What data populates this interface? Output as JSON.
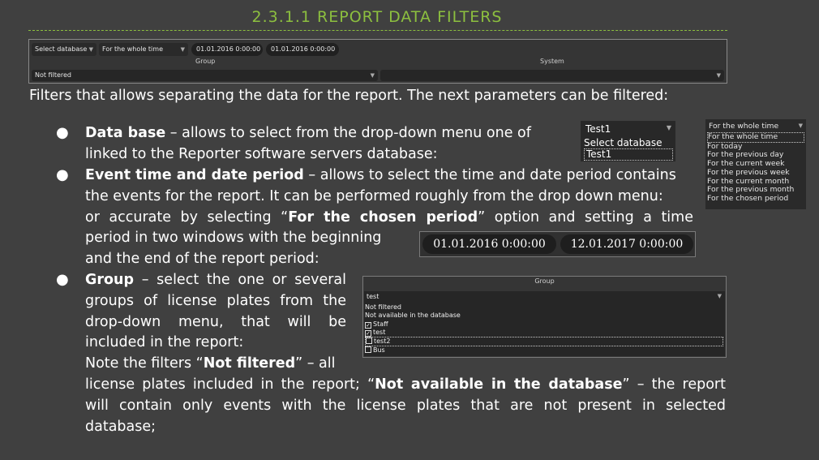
{
  "heading": "2.3.1.1 REPORT DATA FILTERS",
  "panel": {
    "database_select": "Select database",
    "time_select": "For the whole time",
    "date_from": "01.01.2016 0:00:00",
    "date_to": "01.01.2016 0:00:00",
    "group_label": "Group",
    "system_label": "System",
    "group_value": "Not filtered",
    "system_value": ""
  },
  "intro": "Filters that allows separating the data for the report. The next parameters can be filtered:",
  "bullets": {
    "db_title": "Data base",
    "db_text_1": " – allows to select from the drop-down menu one of",
    "db_text_2": "linked to the Reporter software servers database:",
    "time_title": "Event time and date period",
    "time_text_1": " – allows to select the time and date period contains",
    "time_text_2": "the events for the report. It can be performed roughly from the drop down menu:",
    "time_text_3a": "or accurate by selecting “",
    "time_text_3b": "For the chosen period",
    "time_text_3c": "” option and setting a time",
    "time_text_4": "period in two windows with the beginning",
    "time_text_5": "and the end of the report period:",
    "group_title": "Group",
    "group_text_1": " – select the one or several",
    "group_text_2": "groups of license plates from the",
    "group_text_3": "drop-down menu, that will be",
    "group_text_4": "included in the report:",
    "note_1a": "Note the filters “",
    "note_1b": "Not filtered",
    "note_1c": "” – all",
    "note_2a": "license plates included in the report; “",
    "note_2b": "Not available in the database",
    "note_2c": "” – the report",
    "note_3": "will contain only events with the license plates that are not present in selected",
    "note_4": "database;"
  },
  "ex_database": {
    "current": "Test1",
    "options": [
      "Select database",
      "Test1"
    ]
  },
  "ex_time": {
    "current": "For the whole time",
    "options": [
      "For the whole time",
      "For today",
      "For the previous day",
      "For the current week",
      "For the previous week",
      "For the current month",
      "For the previous month",
      "For the chosen period"
    ]
  },
  "ex_dates": {
    "from": "01.01.2016 0:00:00",
    "to": "12.01.2017 0:00:00"
  },
  "ex_group": {
    "label": "Group",
    "current": "test",
    "opt_not_filtered": "Not filtered",
    "opt_not_available": "Not available in the database",
    "items": [
      {
        "label": "Staff",
        "checked": true
      },
      {
        "label": "test",
        "checked": true
      },
      {
        "label": "test2",
        "checked": false
      },
      {
        "label": "Bus",
        "checked": false
      }
    ]
  },
  "colors": {
    "accent": "#8cbf3f",
    "background": "#404040"
  }
}
